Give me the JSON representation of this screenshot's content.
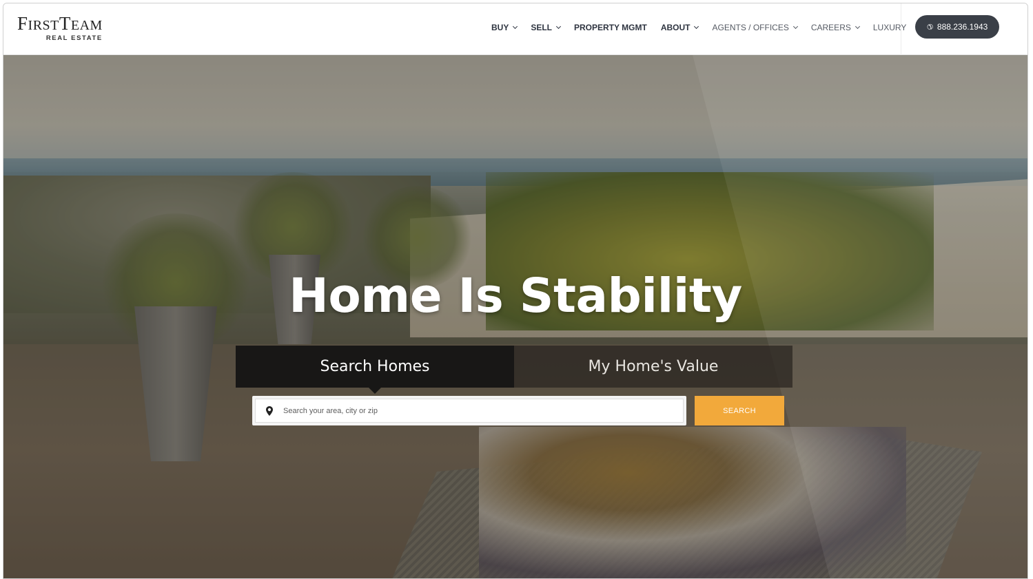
{
  "header": {
    "logo": {
      "main_first": "F",
      "main_rest_1": "IRST",
      "main_t": "T",
      "main_rest_2": "EAM",
      "sub": "REAL ESTATE"
    },
    "nav": [
      {
        "label": "BUY",
        "dropdown": true
      },
      {
        "label": "SELL",
        "dropdown": true
      },
      {
        "label": "PROPERTY MGMT",
        "dropdown": false
      },
      {
        "label": "ABOUT",
        "dropdown": true
      },
      {
        "label": "AGENTS / OFFICES",
        "dropdown": true
      },
      {
        "label": "CAREERS",
        "dropdown": true
      },
      {
        "label": "LUXURY",
        "dropdown": false
      }
    ],
    "phone": {
      "icon": "phone-icon",
      "number": "888.236.1943"
    }
  },
  "hero": {
    "headline": "Home Is Stability",
    "tabs": [
      {
        "label": "Search Homes",
        "active": true
      },
      {
        "label": "My Home's Value",
        "active": false
      }
    ],
    "search": {
      "icon": "map-pin-icon",
      "placeholder": "Search your area, city or zip",
      "value": "",
      "button_label": "SEARCH"
    }
  },
  "colors": {
    "accent": "#f2a93b",
    "phone_button": "#3a3f47",
    "nav_text": "#2e3440"
  }
}
